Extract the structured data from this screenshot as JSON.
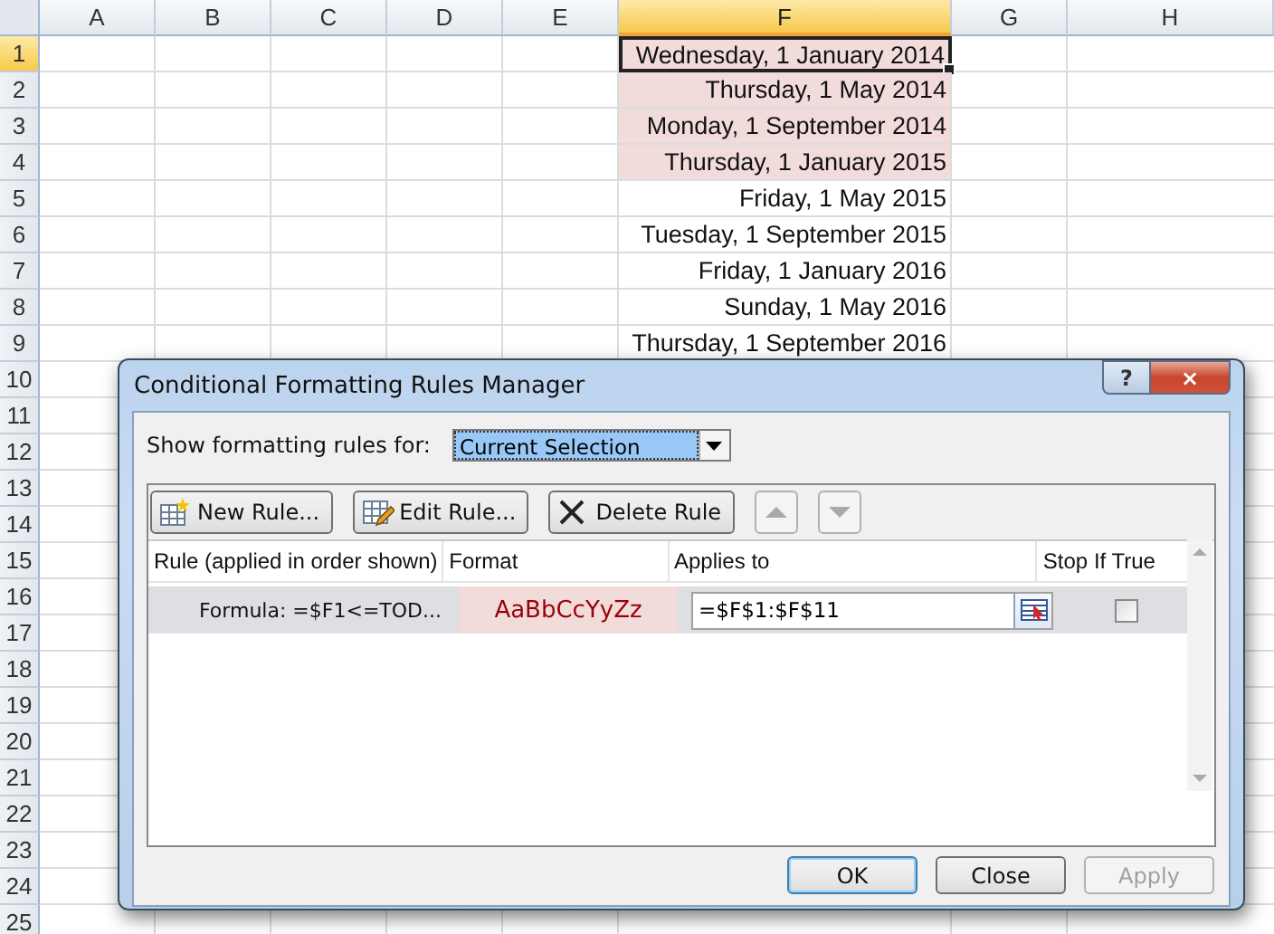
{
  "spreadsheet": {
    "columns": [
      {
        "label": "A",
        "kind": "empty",
        "selected": false
      },
      {
        "label": "B",
        "kind": "empty",
        "selected": false
      },
      {
        "label": "C",
        "kind": "empty",
        "selected": false
      },
      {
        "label": "D",
        "kind": "empty",
        "selected": false
      },
      {
        "label": "E",
        "kind": "empty",
        "selected": false
      },
      {
        "label": "F",
        "kind": "data",
        "selected": true
      },
      {
        "label": "G",
        "kind": "empty",
        "selected": false
      },
      {
        "label": "H",
        "kind": "empty",
        "selected": false
      }
    ],
    "rows": [
      {
        "number": "1",
        "selected": true,
        "value": "Wednesday, 1 January 2014",
        "highlighted": true
      },
      {
        "number": "2",
        "selected": false,
        "value": "Thursday, 1 May 2014",
        "highlighted": true
      },
      {
        "number": "3",
        "selected": false,
        "value": "Monday, 1 September 2014",
        "highlighted": true
      },
      {
        "number": "4",
        "selected": false,
        "value": "Thursday, 1 January 2015",
        "highlighted": true
      },
      {
        "number": "5",
        "selected": false,
        "value": "Friday, 1 May 2015",
        "highlighted": false
      },
      {
        "number": "6",
        "selected": false,
        "value": "Tuesday, 1 September 2015",
        "highlighted": false
      },
      {
        "number": "7",
        "selected": false,
        "value": "Friday, 1 January 2016",
        "highlighted": false
      },
      {
        "number": "8",
        "selected": false,
        "value": "Sunday, 1 May 2016",
        "highlighted": false
      },
      {
        "number": "9",
        "selected": false,
        "value": "Thursday, 1 September 2016",
        "highlighted": false
      },
      {
        "number": "10",
        "selected": false
      },
      {
        "number": "11",
        "selected": false
      },
      {
        "number": "12",
        "selected": false
      },
      {
        "number": "13",
        "selected": false
      },
      {
        "number": "14",
        "selected": false
      },
      {
        "number": "15",
        "selected": false
      },
      {
        "number": "16",
        "selected": false
      },
      {
        "number": "17",
        "selected": false
      },
      {
        "number": "18",
        "selected": false
      },
      {
        "number": "19",
        "selected": false
      },
      {
        "number": "20",
        "selected": false
      },
      {
        "number": "21",
        "selected": false
      },
      {
        "number": "22",
        "selected": false
      },
      {
        "number": "23",
        "selected": false
      },
      {
        "number": "24",
        "selected": false
      },
      {
        "number": "25",
        "selected": false
      }
    ]
  },
  "dialog": {
    "title": "Conditional Formatting Rules Manager",
    "help": "?",
    "close": "×",
    "scope": {
      "label": "Show formatting rules for:",
      "value": "Current Selection"
    },
    "toolbar": [
      {
        "kind": "new",
        "label": "New Rule...",
        "disabled": false
      },
      {
        "kind": "edit",
        "label": "Edit Rule...",
        "disabled": false
      },
      {
        "kind": "delete",
        "label": "Delete Rule",
        "disabled": false
      },
      {
        "kind": "up",
        "disabled": true
      },
      {
        "kind": "down",
        "disabled": true
      }
    ],
    "table": {
      "columns": [
        "Rule (applied in order shown)",
        "Format",
        "Applies to",
        "Stop If True"
      ],
      "rows": [
        {
          "rule": "Formula: =$F1<=TOD...",
          "format": "AaBbCcYyZz",
          "applies_to": "=$F$1:$F$11",
          "stop_if_true": false,
          "selected": true
        }
      ]
    },
    "buttons": [
      {
        "label": "OK",
        "default": true,
        "disabled": false
      },
      {
        "label": "Close",
        "default": false,
        "disabled": false
      },
      {
        "label": "Apply",
        "default": false,
        "disabled": true
      }
    ]
  }
}
